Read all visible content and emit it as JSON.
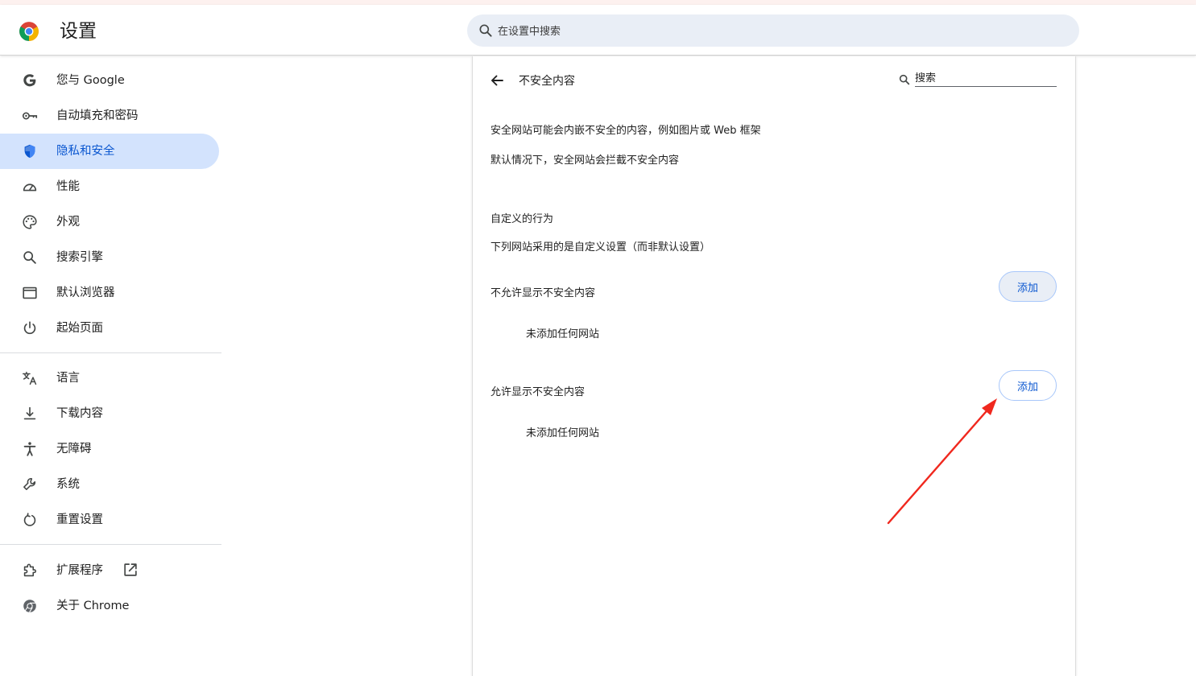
{
  "header": {
    "app_title": "设置",
    "search_placeholder": "在设置中搜索"
  },
  "sidebar": {
    "items": [
      {
        "label": "您与 Google",
        "icon": "google-g-icon"
      },
      {
        "label": "自动填充和密码",
        "icon": "key-icon"
      },
      {
        "label": "隐私和安全",
        "icon": "shield-icon",
        "active": true
      },
      {
        "label": "性能",
        "icon": "speedometer-icon"
      },
      {
        "label": "外观",
        "icon": "palette-icon"
      },
      {
        "label": "搜索引擎",
        "icon": "search-icon"
      },
      {
        "label": "默认浏览器",
        "icon": "browser-window-icon"
      },
      {
        "label": "起始页面",
        "icon": "power-icon"
      },
      {
        "label": "语言",
        "icon": "translate-icon"
      },
      {
        "label": "下载内容",
        "icon": "download-icon"
      },
      {
        "label": "无障碍",
        "icon": "accessibility-icon"
      },
      {
        "label": "系统",
        "icon": "wrench-icon"
      },
      {
        "label": "重置设置",
        "icon": "reset-icon"
      },
      {
        "label": "扩展程序",
        "icon": "puzzle-icon",
        "external_icon": "open-in-new-icon"
      },
      {
        "label": "关于 Chrome",
        "icon": "chrome-icon"
      }
    ]
  },
  "page": {
    "title": "不安全内容",
    "search_placeholder": "搜索",
    "description_1": "安全网站可能会内嵌不安全的内容，例如图片或 Web 框架",
    "description_2": "默认情况下，安全网站会拦截不安全内容",
    "custom_heading": "自定义的行为",
    "custom_subheading": "下列网站采用的是自定义设置（而非默认设置）",
    "block_section": {
      "label": "不允许显示不安全内容",
      "add_label": "添加",
      "empty_text": "未添加任何网站"
    },
    "allow_section": {
      "label": "允许显示不安全内容",
      "add_label": "添加",
      "empty_text": "未添加任何网站"
    }
  },
  "colors": {
    "accent": "#0b57d0",
    "active_nav_bg": "#d3e3fd",
    "annotation_arrow": "#f0281e"
  }
}
